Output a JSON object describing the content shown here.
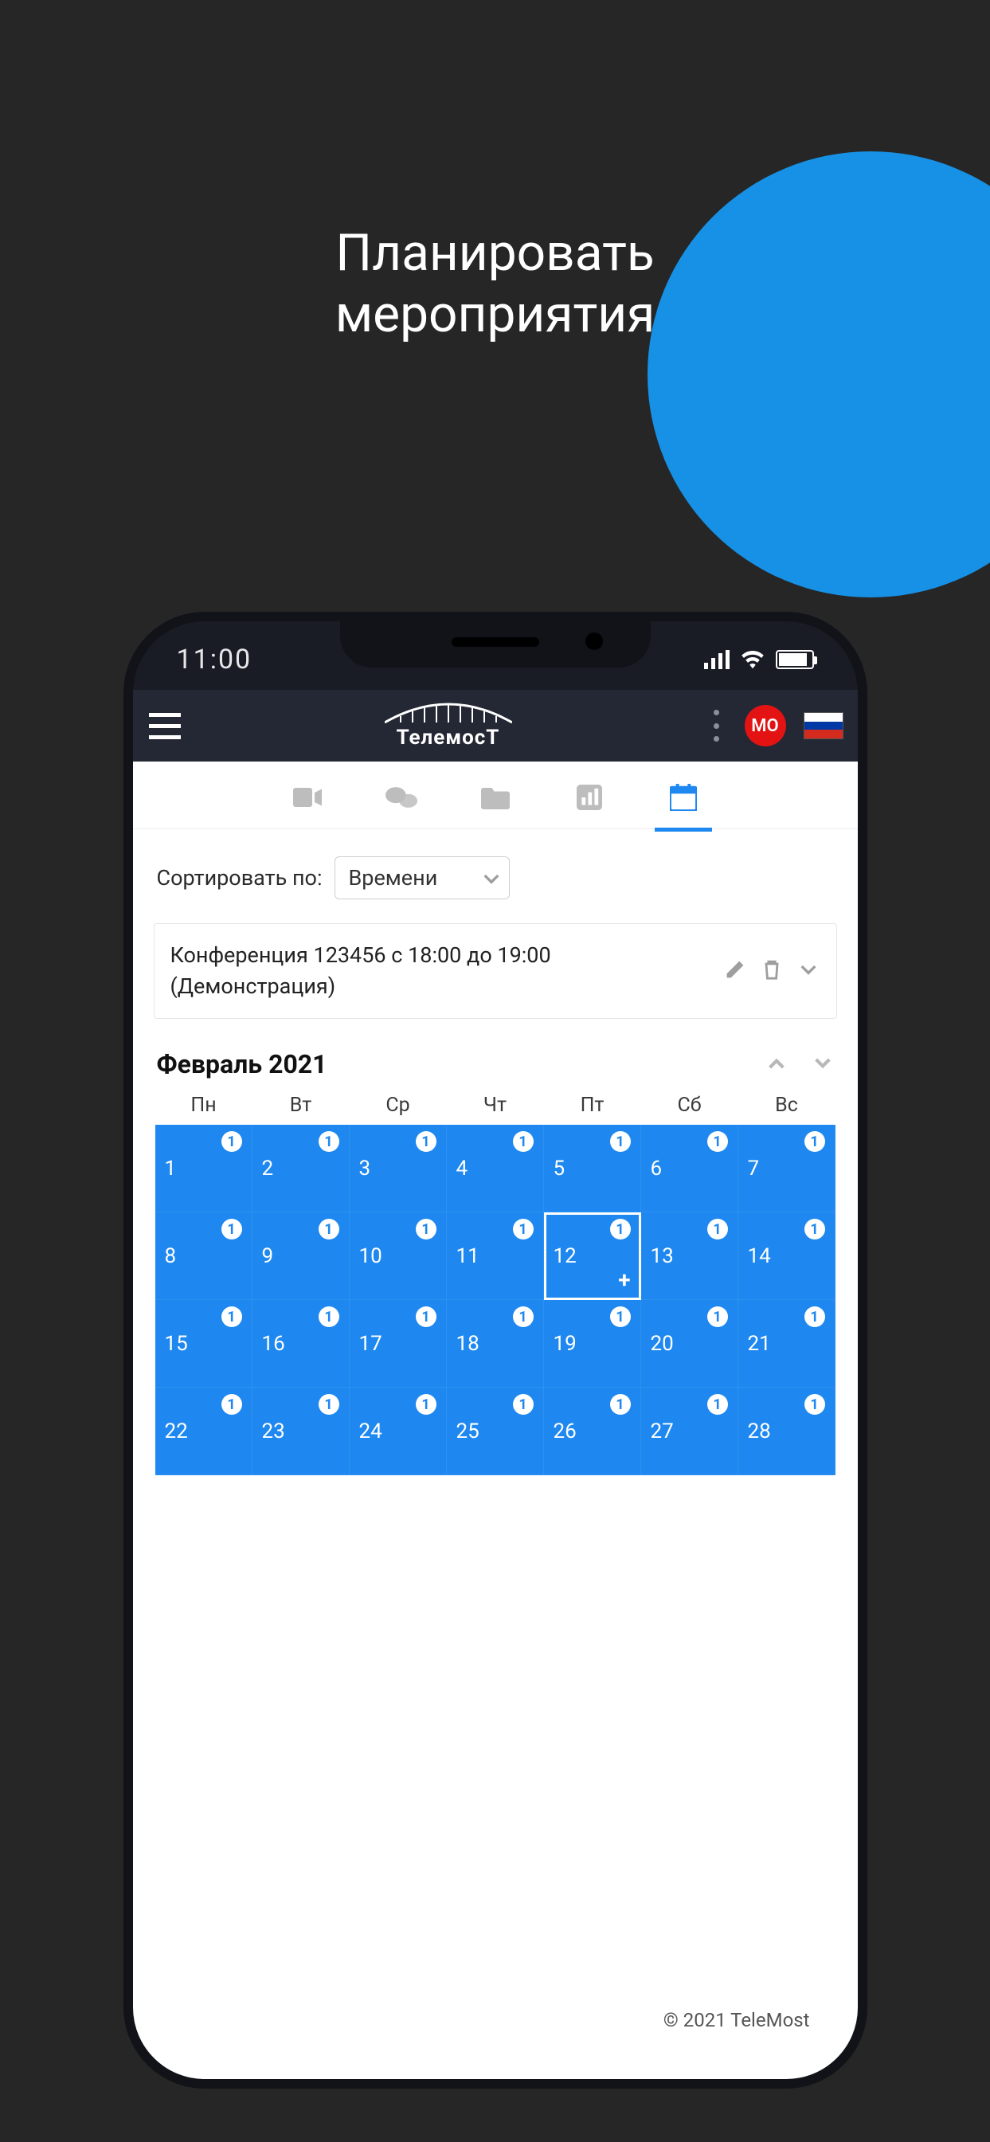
{
  "heading": {
    "line1": "Планировать",
    "line2": "мероприятия"
  },
  "status": {
    "time": "11:00"
  },
  "header": {
    "brand": "ТелемосТ",
    "avatar_initials": "МО"
  },
  "tabs": {
    "items": [
      "video",
      "chat",
      "files",
      "stats",
      "calendar"
    ],
    "active_index": 4
  },
  "sort": {
    "label": "Сортировать по:",
    "value": "Времени"
  },
  "event_card": {
    "text": "Конференция 123456 с 18:00 до 19:00 (Демонстрация)"
  },
  "calendar": {
    "month_label": "Февраль 2021",
    "dow": [
      "Пн",
      "Вт",
      "Ср",
      "Чт",
      "Пт",
      "Сб",
      "Вс"
    ],
    "days": [
      {
        "n": 1,
        "b": 1
      },
      {
        "n": 2,
        "b": 1
      },
      {
        "n": 3,
        "b": 1
      },
      {
        "n": 4,
        "b": 1
      },
      {
        "n": 5,
        "b": 1
      },
      {
        "n": 6,
        "b": 1
      },
      {
        "n": 7,
        "b": 1
      },
      {
        "n": 8,
        "b": 1
      },
      {
        "n": 9,
        "b": 1
      },
      {
        "n": 10,
        "b": 1
      },
      {
        "n": 11,
        "b": 1
      },
      {
        "n": 12,
        "b": 1,
        "selected": true
      },
      {
        "n": 13,
        "b": 1
      },
      {
        "n": 14,
        "b": 1
      },
      {
        "n": 15,
        "b": 1
      },
      {
        "n": 16,
        "b": 1
      },
      {
        "n": 17,
        "b": 1
      },
      {
        "n": 18,
        "b": 1
      },
      {
        "n": 19,
        "b": 1
      },
      {
        "n": 20,
        "b": 1
      },
      {
        "n": 21,
        "b": 1
      },
      {
        "n": 22,
        "b": 1
      },
      {
        "n": 23,
        "b": 1
      },
      {
        "n": 24,
        "b": 1
      },
      {
        "n": 25,
        "b": 1
      },
      {
        "n": 26,
        "b": 1
      },
      {
        "n": 27,
        "b": 1
      },
      {
        "n": 28,
        "b": 1
      }
    ]
  },
  "footer": {
    "copyright": "© 2021 TeleMost"
  },
  "colors": {
    "accent": "#1e88f0",
    "danger": "#e31313",
    "dark": "#262626"
  }
}
